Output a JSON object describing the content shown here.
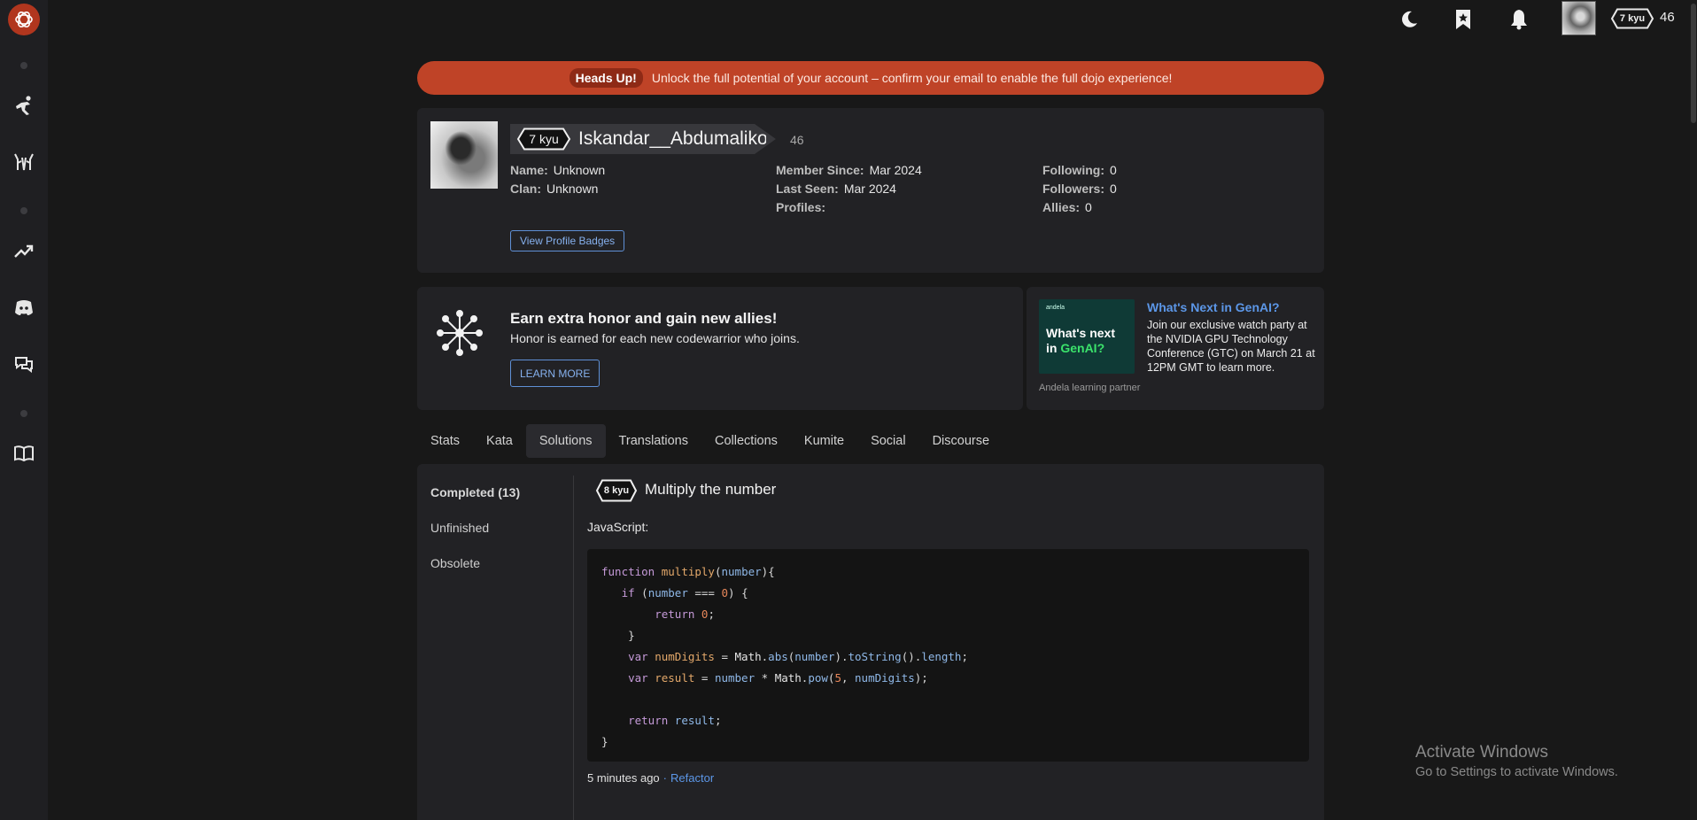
{
  "topbar": {
    "rank": "7 kyu",
    "honor": "46"
  },
  "headsup": {
    "label": "Heads Up!",
    "message": "Unlock the full potential of your account – confirm your email to enable the full dojo experience!"
  },
  "profile": {
    "rank": "7 kyu",
    "username": "Iskandar__Abdumalikov",
    "honor": "46",
    "name_label": "Name:",
    "name_value": "Unknown",
    "clan_label": "Clan:",
    "clan_value": "Unknown",
    "member_since_label": "Member Since:",
    "member_since_value": "Mar 2024",
    "last_seen_label": "Last Seen:",
    "last_seen_value": "Mar 2024",
    "profiles_label": "Profiles:",
    "following_label": "Following:",
    "following_value": "0",
    "followers_label": "Followers:",
    "followers_value": "0",
    "allies_label": "Allies:",
    "allies_value": "0",
    "badges_button": "View Profile Badges"
  },
  "promo": {
    "title": "Earn extra honor and gain new allies!",
    "subtitle": "Honor is earned for each new codewarrior who joins.",
    "button": "LEARN MORE"
  },
  "ad": {
    "image_brand": "andela",
    "image_line1": "What's next",
    "image_line2_a": "in ",
    "image_line2_b": "GenAI?",
    "title": "What's Next in GenAI?",
    "body": "Join our exclusive watch party at the NVIDIA GPU Technology Conference (GTC) on March 21 at 12PM GMT to learn more.",
    "footer": "Andela learning partner"
  },
  "tabs": [
    "Stats",
    "Kata",
    "Solutions",
    "Translations",
    "Collections",
    "Kumite",
    "Social",
    "Discourse"
  ],
  "solutions": {
    "sidebar": [
      "Completed (13)",
      "Unfinished",
      "Obsolete"
    ],
    "kata_rank": "8 kyu",
    "kata_title": "Multiply the number",
    "language": "JavaScript:",
    "time_ago": "5 minutes ago",
    "separator": "·",
    "refactor": "Refactor"
  },
  "windows": {
    "title": "Activate Windows",
    "subtitle": "Go to Settings to activate Windows."
  },
  "colors": {
    "accent": "#5c97e8",
    "headsup_bg": "#bf4327",
    "logo_red": "#b1361e",
    "panel_bg": "#222225",
    "page_bg": "#181818"
  },
  "icons": {
    "rail": [
      "codewars-logo-icon",
      "kata-practice-icon",
      "sparring-icon",
      "leaderboard-icon",
      "discord-icon",
      "forum-icon",
      "docs-book-icon"
    ],
    "top": [
      "moon-icon",
      "bookmark-icon",
      "bell-icon"
    ]
  }
}
